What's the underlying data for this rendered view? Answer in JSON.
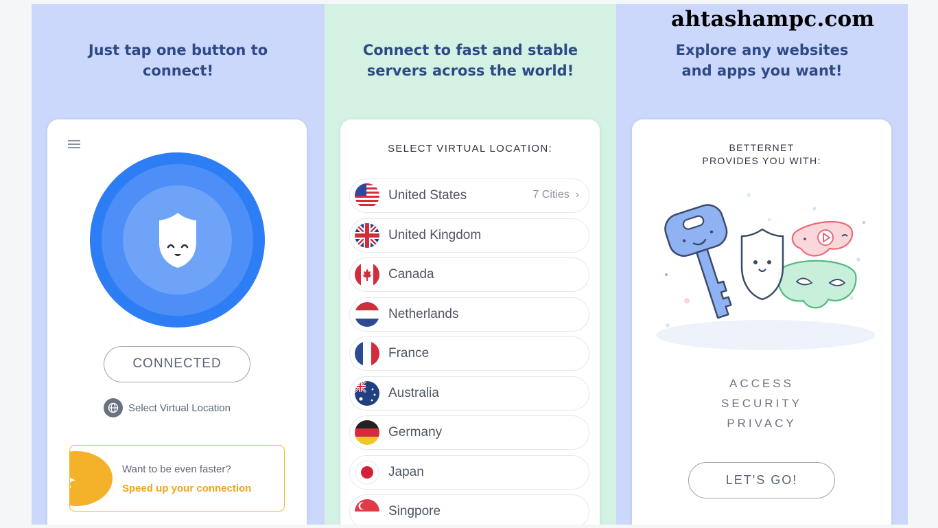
{
  "watermark": "ahtashampc.com",
  "panel1": {
    "headline": [
      "Just tap one button to",
      "connect!"
    ],
    "status_label": "CONNECTED",
    "select_location_label": "Select Virtual Location",
    "promo_question": "Want to be even faster?",
    "promo_cta": "Speed up your connection",
    "colors": {
      "power": "#2d7df4",
      "promo": "#f3b22a"
    }
  },
  "panel2": {
    "headline": [
      "Connect to fast and stable",
      "servers across the world!"
    ],
    "title": "SELECT VIRTUAL LOCATION:",
    "countries": [
      {
        "name": "United States",
        "cities": "7 Cities",
        "flag": "us-flag-icon"
      },
      {
        "name": "United Kingdom",
        "flag": "uk-flag-icon"
      },
      {
        "name": "Canada",
        "flag": "canada-flag-icon"
      },
      {
        "name": "Netherlands",
        "flag": "netherlands-flag-icon"
      },
      {
        "name": "France",
        "flag": "france-flag-icon"
      },
      {
        "name": "Australia",
        "flag": "australia-flag-icon"
      },
      {
        "name": "Germany",
        "flag": "germany-flag-icon"
      },
      {
        "name": "Japan",
        "flag": "japan-flag-icon"
      },
      {
        "name": "Singpore",
        "flag": "singapore-flag-icon"
      }
    ]
  },
  "panel3": {
    "headline": [
      "Explore any websites",
      "and apps you want!"
    ],
    "title": [
      "BETTERNET",
      "PROVIDES YOU WITH:"
    ],
    "features": [
      "ACCESS",
      "SECURITY",
      "PRIVACY"
    ],
    "cta": "LET'S GO!"
  }
}
